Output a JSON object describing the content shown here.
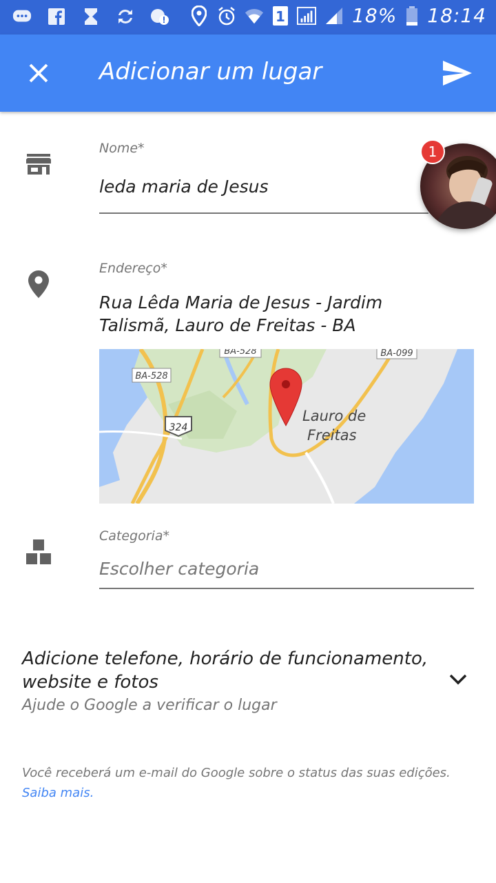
{
  "status_bar": {
    "battery": "18%",
    "time": "18:14",
    "sim": "1"
  },
  "app_bar": {
    "title": "Adicionar um lugar",
    "close_icon": "close-icon",
    "send_icon": "send-icon",
    "background": "#4285f4"
  },
  "name_field": {
    "label": "Nome*",
    "value": "leda maria de Jesus",
    "icon": "store-icon"
  },
  "address_field": {
    "label": "Endereço*",
    "value": "Rua Lêda Maria de Jesus - Jardim Talismã, Lauro de Freitas - BA",
    "icon": "location-pin-icon"
  },
  "map": {
    "city_label_line1": "Lauro de",
    "city_label_line2": "Freitas",
    "road_labels": [
      "BA-528",
      "BA-528",
      "BA-099",
      "324"
    ]
  },
  "category_field": {
    "label": "Categoria*",
    "placeholder": "Escolher categoria",
    "icon": "category-icon"
  },
  "more_info": {
    "title": "Adicione telefone, horário de funcionamento, website e fotos",
    "subtitle": "Ajude o Google a verificar o lugar"
  },
  "footer": {
    "text": "Você receberá um e-mail do Google sobre o status das suas edições.",
    "link": "Saiba mais."
  },
  "chat_head": {
    "badge_count": "1"
  }
}
